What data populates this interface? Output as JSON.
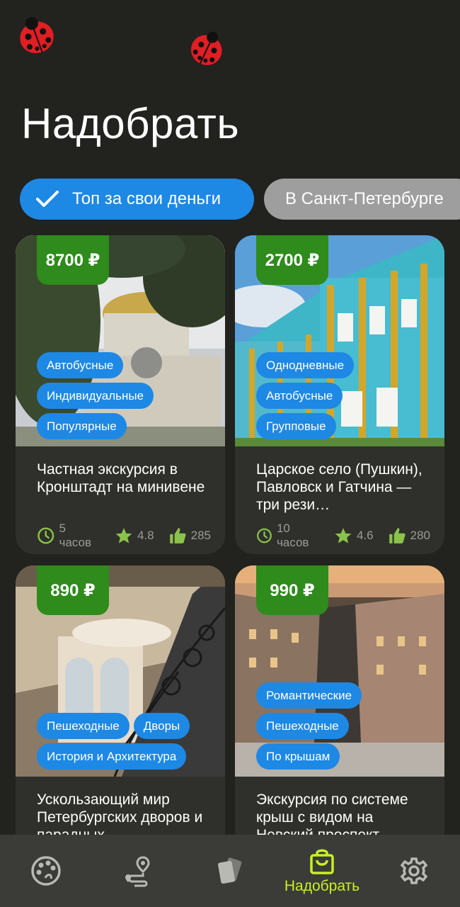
{
  "header": {
    "title": "Надобрать"
  },
  "filters": [
    {
      "label": "Топ за свои деньги",
      "active": true,
      "icon": "check-icon"
    },
    {
      "label": "В Санкт-Петербурге",
      "active": false
    }
  ],
  "cards": [
    {
      "price": "8700 ₽",
      "tags": [
        "Автобусные",
        "Индивидуальные",
        "Популярные"
      ],
      "title": "Частная экскурсия в Кронштадт на минивене",
      "duration": "5 часов",
      "rating": "4.8",
      "likes": "285"
    },
    {
      "price": "2700 ₽",
      "tags": [
        "Однодневные",
        "Автобусные",
        "Групповые"
      ],
      "title": "Царское село (Пушкин), Павловск и Гатчина — три рези…",
      "duration": "10 часов",
      "rating": "4.6",
      "likes": "280"
    },
    {
      "price": "890 ₽",
      "tags": [
        "Пешеходные",
        "Дворы",
        "История и Архитектура"
      ],
      "title": "Ускользающий мир Петербургских дворов и парадных",
      "duration": "",
      "rating": "",
      "likes": ""
    },
    {
      "price": "990 ₽",
      "tags": [
        "Романтические",
        "Пешеходные",
        "По крышам"
      ],
      "title": "Экскурсия по системе крыш с видом на Невский проспект",
      "duration": "",
      "rating": "",
      "likes": ""
    }
  ],
  "bottom_nav": [
    {
      "icon": "palette-icon",
      "label": ""
    },
    {
      "icon": "route-icon",
      "label": ""
    },
    {
      "icon": "cards-icon",
      "label": ""
    },
    {
      "icon": "shopping-bag-icon",
      "label": "Надобрать",
      "active": true
    },
    {
      "icon": "gear-icon",
      "label": ""
    }
  ],
  "colors": {
    "background": "#22221f",
    "card": "#2f302b",
    "accent_blue": "#1e88e5",
    "price_green": "#2e8b1c",
    "active_nav": "#c8f025",
    "meta_icon": "#8bc34a"
  }
}
